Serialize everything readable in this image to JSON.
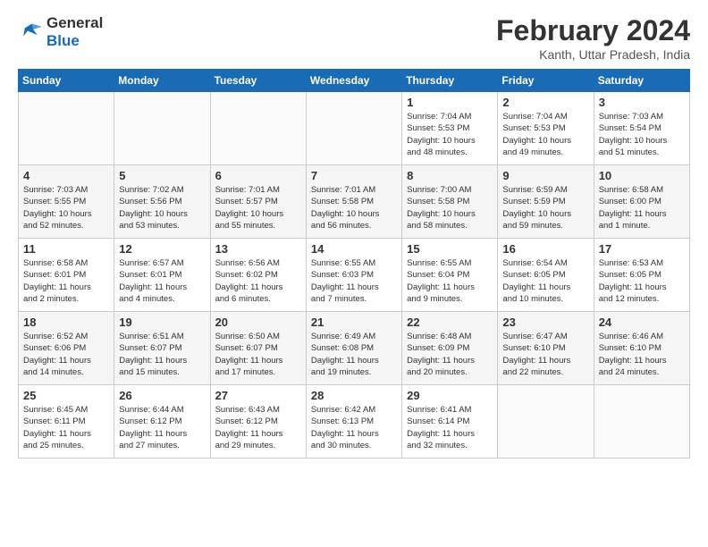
{
  "logo": {
    "line1": "General",
    "line2": "Blue"
  },
  "title": "February 2024",
  "location": "Kanth, Uttar Pradesh, India",
  "headers": [
    "Sunday",
    "Monday",
    "Tuesday",
    "Wednesday",
    "Thursday",
    "Friday",
    "Saturday"
  ],
  "weeks": [
    [
      {
        "day": "",
        "info": ""
      },
      {
        "day": "",
        "info": ""
      },
      {
        "day": "",
        "info": ""
      },
      {
        "day": "",
        "info": ""
      },
      {
        "day": "1",
        "info": "Sunrise: 7:04 AM\nSunset: 5:53 PM\nDaylight: 10 hours\nand 48 minutes."
      },
      {
        "day": "2",
        "info": "Sunrise: 7:04 AM\nSunset: 5:53 PM\nDaylight: 10 hours\nand 49 minutes."
      },
      {
        "day": "3",
        "info": "Sunrise: 7:03 AM\nSunset: 5:54 PM\nDaylight: 10 hours\nand 51 minutes."
      }
    ],
    [
      {
        "day": "4",
        "info": "Sunrise: 7:03 AM\nSunset: 5:55 PM\nDaylight: 10 hours\nand 52 minutes."
      },
      {
        "day": "5",
        "info": "Sunrise: 7:02 AM\nSunset: 5:56 PM\nDaylight: 10 hours\nand 53 minutes."
      },
      {
        "day": "6",
        "info": "Sunrise: 7:01 AM\nSunset: 5:57 PM\nDaylight: 10 hours\nand 55 minutes."
      },
      {
        "day": "7",
        "info": "Sunrise: 7:01 AM\nSunset: 5:58 PM\nDaylight: 10 hours\nand 56 minutes."
      },
      {
        "day": "8",
        "info": "Sunrise: 7:00 AM\nSunset: 5:58 PM\nDaylight: 10 hours\nand 58 minutes."
      },
      {
        "day": "9",
        "info": "Sunrise: 6:59 AM\nSunset: 5:59 PM\nDaylight: 10 hours\nand 59 minutes."
      },
      {
        "day": "10",
        "info": "Sunrise: 6:58 AM\nSunset: 6:00 PM\nDaylight: 11 hours\nand 1 minute."
      }
    ],
    [
      {
        "day": "11",
        "info": "Sunrise: 6:58 AM\nSunset: 6:01 PM\nDaylight: 11 hours\nand 2 minutes."
      },
      {
        "day": "12",
        "info": "Sunrise: 6:57 AM\nSunset: 6:01 PM\nDaylight: 11 hours\nand 4 minutes."
      },
      {
        "day": "13",
        "info": "Sunrise: 6:56 AM\nSunset: 6:02 PM\nDaylight: 11 hours\nand 6 minutes."
      },
      {
        "day": "14",
        "info": "Sunrise: 6:55 AM\nSunset: 6:03 PM\nDaylight: 11 hours\nand 7 minutes."
      },
      {
        "day": "15",
        "info": "Sunrise: 6:55 AM\nSunset: 6:04 PM\nDaylight: 11 hours\nand 9 minutes."
      },
      {
        "day": "16",
        "info": "Sunrise: 6:54 AM\nSunset: 6:05 PM\nDaylight: 11 hours\nand 10 minutes."
      },
      {
        "day": "17",
        "info": "Sunrise: 6:53 AM\nSunset: 6:05 PM\nDaylight: 11 hours\nand 12 minutes."
      }
    ],
    [
      {
        "day": "18",
        "info": "Sunrise: 6:52 AM\nSunset: 6:06 PM\nDaylight: 11 hours\nand 14 minutes."
      },
      {
        "day": "19",
        "info": "Sunrise: 6:51 AM\nSunset: 6:07 PM\nDaylight: 11 hours\nand 15 minutes."
      },
      {
        "day": "20",
        "info": "Sunrise: 6:50 AM\nSunset: 6:07 PM\nDaylight: 11 hours\nand 17 minutes."
      },
      {
        "day": "21",
        "info": "Sunrise: 6:49 AM\nSunset: 6:08 PM\nDaylight: 11 hours\nand 19 minutes."
      },
      {
        "day": "22",
        "info": "Sunrise: 6:48 AM\nSunset: 6:09 PM\nDaylight: 11 hours\nand 20 minutes."
      },
      {
        "day": "23",
        "info": "Sunrise: 6:47 AM\nSunset: 6:10 PM\nDaylight: 11 hours\nand 22 minutes."
      },
      {
        "day": "24",
        "info": "Sunrise: 6:46 AM\nSunset: 6:10 PM\nDaylight: 11 hours\nand 24 minutes."
      }
    ],
    [
      {
        "day": "25",
        "info": "Sunrise: 6:45 AM\nSunset: 6:11 PM\nDaylight: 11 hours\nand 25 minutes."
      },
      {
        "day": "26",
        "info": "Sunrise: 6:44 AM\nSunset: 6:12 PM\nDaylight: 11 hours\nand 27 minutes."
      },
      {
        "day": "27",
        "info": "Sunrise: 6:43 AM\nSunset: 6:12 PM\nDaylight: 11 hours\nand 29 minutes."
      },
      {
        "day": "28",
        "info": "Sunrise: 6:42 AM\nSunset: 6:13 PM\nDaylight: 11 hours\nand 30 minutes."
      },
      {
        "day": "29",
        "info": "Sunrise: 6:41 AM\nSunset: 6:14 PM\nDaylight: 11 hours\nand 32 minutes."
      },
      {
        "day": "",
        "info": ""
      },
      {
        "day": "",
        "info": ""
      }
    ]
  ]
}
